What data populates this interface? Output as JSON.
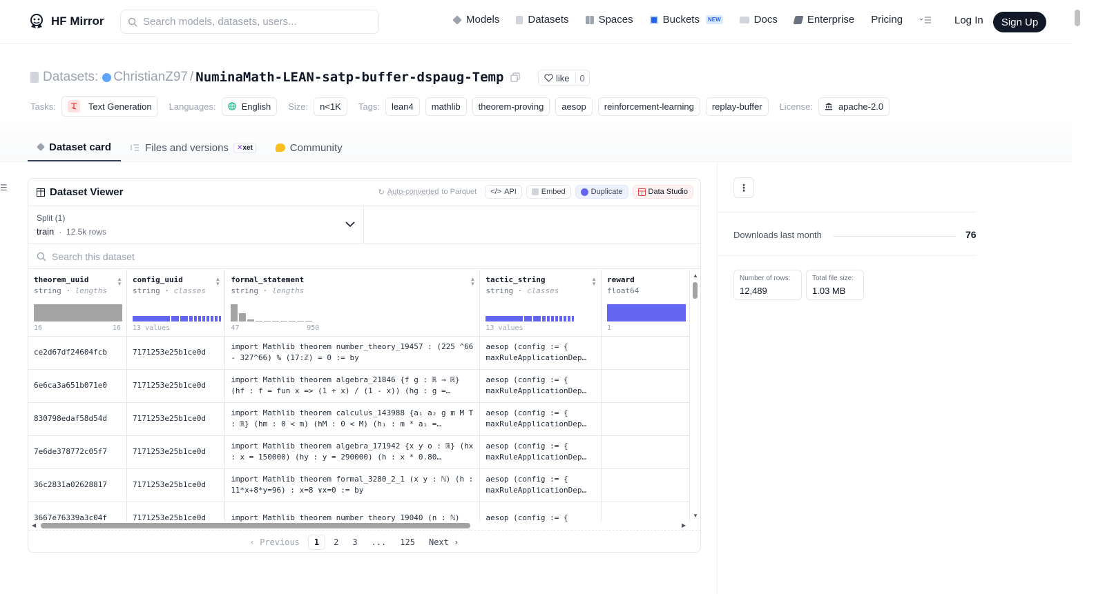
{
  "nav": {
    "brand": "HF Mirror",
    "search_placeholder": "Search models, datasets, users...",
    "links": [
      {
        "label": "Models",
        "color": "#9ca3af"
      },
      {
        "label": "Datasets",
        "color": "#d1d5db"
      },
      {
        "label": "Spaces",
        "color": "#9ca3af"
      },
      {
        "label": "Buckets",
        "color": "#2563eb"
      },
      {
        "label": "Docs",
        "color": "#9ca3af"
      },
      {
        "label": "Enterprise",
        "color": "#6b7280"
      }
    ],
    "new_badge": "NEW",
    "pricing": "Pricing",
    "login": "Log In",
    "signup": "Sign Up"
  },
  "header": {
    "section": "Datasets:",
    "owner": "ChristianZ97",
    "separator": "/",
    "repo": "NuminaMath-LEAN-satp-buffer-dspaug-Temp",
    "like_label": "like",
    "like_count": "0",
    "tasks_label": "Tasks:",
    "task": "Text Generation",
    "languages_label": "Languages:",
    "language": "English",
    "size_label": "Size:",
    "size": "n<1K",
    "tags_label": "Tags:",
    "tags": [
      "lean4",
      "mathlib",
      "theorem-proving",
      "aesop",
      "reinforcement-learning",
      "replay-buffer"
    ],
    "license_label": "License:",
    "license": "apache-2.0"
  },
  "tabs": {
    "card": "Dataset card",
    "files": "Files and versions",
    "xet": "xet",
    "community": "Community"
  },
  "viewer": {
    "title": "Dataset Viewer",
    "auto_converted": "Auto-converted",
    "to_parquet": "to Parquet",
    "api": "API",
    "embed": "Embed",
    "duplicate": "Duplicate",
    "data_studio": "Data Studio",
    "split_label": "Split (1)",
    "split_value": "train",
    "split_rows": "12.5k rows",
    "search_placeholder": "Search this dataset",
    "columns": [
      {
        "name": "theorem_uuid",
        "type": "string",
        "kind": "lengths",
        "lo": "16",
        "hi": "16"
      },
      {
        "name": "config_uuid",
        "type": "string",
        "kind": "classes",
        "lo": "13 values",
        "hi": ""
      },
      {
        "name": "formal_statement",
        "type": "string",
        "kind": "lengths",
        "lo": "47",
        "hi": "950"
      },
      {
        "name": "tactic_string",
        "type": "string",
        "kind": "classes",
        "lo": "13 values",
        "hi": ""
      },
      {
        "name": "reward",
        "type": "float64",
        "kind": "",
        "lo": "1",
        "hi": ""
      }
    ],
    "rows": [
      [
        "ce2d67df24604fcb",
        "7171253e25b1ce0d",
        "import Mathlib theorem number_theory_19457 : (225 ^66 - 327^66) % (17:ℤ) = 0 := by",
        "aesop (config := { maxRuleApplicationDep…",
        ""
      ],
      [
        "6e6ca3a651b071e0",
        "7171253e25b1ce0d",
        "import Mathlib theorem algebra_21846 {f g : ℝ → ℝ} (hf : f = fun x => (1 + x) / (1 - x)) (hg : g =…",
        "aesop (config := { maxRuleApplicationDep…",
        ""
      ],
      [
        "830798edaf58d54d",
        "7171253e25b1ce0d",
        "import Mathlib theorem calculus_143988 {a₁ a₂ g m M T : ℝ} (hm : 0 < m) (hM : 0 < M) (h₁ : m * a₁ =…",
        "aesop (config := { maxRuleApplicationDep…",
        ""
      ],
      [
        "7e6de378772c05f7",
        "7171253e25b1ce0d",
        "import Mathlib theorem algebra_171942 {x y o : ℝ} (hx : x = 150000) (hy : y = 290000) (h : x * 0.80…",
        "aesop (config := { maxRuleApplicationDep…",
        ""
      ],
      [
        "36c2831a02628817",
        "7171253e25b1ce0d",
        "import Mathlib theorem formal_3280_2_1 (x y : ℕ) (h : 11*x+8*y=96) : x=8 ∨x=0 := by",
        "aesop (config := { maxRuleApplicationDep…",
        ""
      ],
      [
        "3667e76339a3c04f",
        "7171253e25b1ce0d",
        "import Mathlib theorem number_theory_19040 (n : ℕ)",
        "aesop (config := {",
        ""
      ]
    ],
    "pager": {
      "prev": "Previous",
      "pages": [
        "1",
        "2",
        "3",
        "...",
        "125"
      ],
      "current": "1",
      "next": "Next"
    }
  },
  "sidebar": {
    "downloads_label": "Downloads last month",
    "downloads_value": "76",
    "rows_label": "Number of rows:",
    "rows_value": "12,489",
    "filesize_label": "Total file size:",
    "filesize_value": "1.03 MB"
  }
}
